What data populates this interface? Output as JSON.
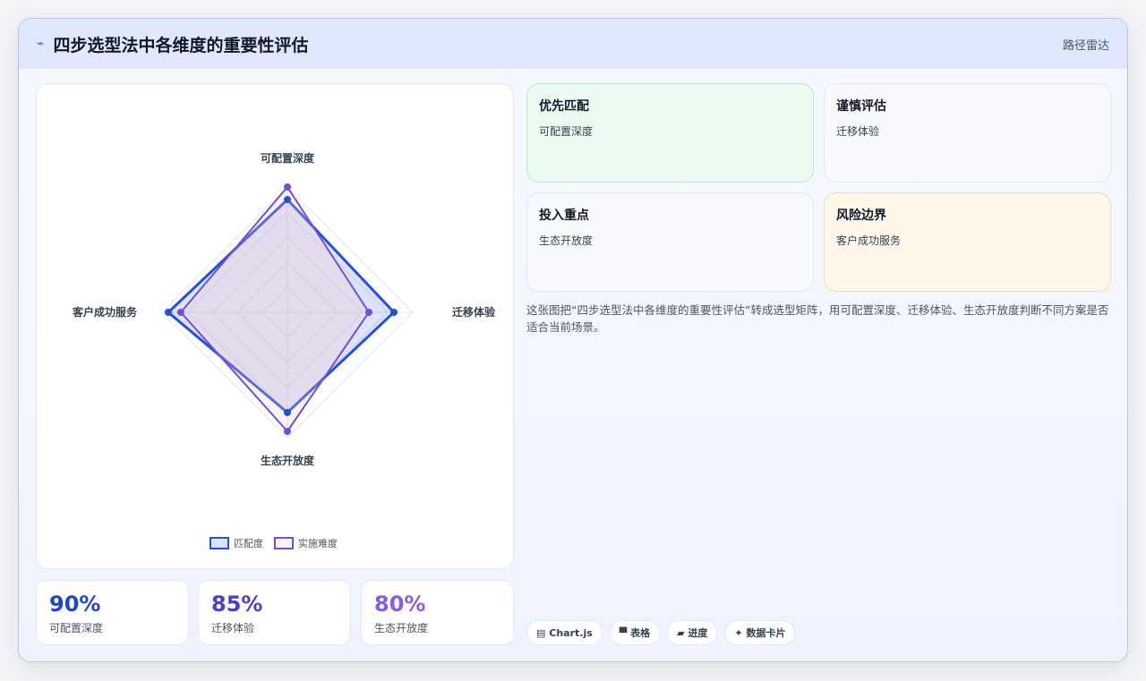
{
  "header": {
    "icon": "sparkline-icon",
    "title": "四步选型法中各维度的重要性评估",
    "right_label": "路径雷达"
  },
  "chart_data": {
    "type": "radar",
    "axes": [
      "可配置深度",
      "迁移体验",
      "生态开放度",
      "客户成功服务"
    ],
    "rmax": 100,
    "series": [
      {
        "name": "匹配度",
        "values": [
          90,
          85,
          80,
          95
        ],
        "color": "#2451d6",
        "fill": "rgba(59,100,230,0.18)"
      },
      {
        "name": "实施难度",
        "values": [
          100,
          65,
          95,
          85
        ],
        "color": "#6d4fd8",
        "fill": "rgba(250,200,200,0.25)"
      }
    ],
    "legend_position": "bottom"
  },
  "stats": [
    {
      "value": "90%",
      "label": "可配置深度",
      "color": "#2045c8"
    },
    {
      "value": "85%",
      "label": "迁移体验",
      "color": "#4b3fc6"
    },
    {
      "value": "80%",
      "label": "生态开放度",
      "color": "#8b5be6"
    }
  ],
  "cards": [
    {
      "title": "优先匹配",
      "text": "可配置深度",
      "bg": "#ecfbf2",
      "border": "#bfe8cf"
    },
    {
      "title": "谨慎评估",
      "text": "迁移体验",
      "bg": "#f8fafd",
      "border": "#e2e8f0"
    },
    {
      "title": "投入重点",
      "text": "生态开放度",
      "bg": "#f8fafd",
      "border": "#e2e8f0"
    },
    {
      "title": "风险边界",
      "text": "客户成功服务",
      "bg": "#fff7e9",
      "border": "#f4dcaa"
    }
  ],
  "description": "这张图把“四步选型法中各维度的重要性评估”转成选型矩阵，用可配置深度、迁移体验、生态开放度判断不同方案是否适合当前场景。",
  "tags": [
    {
      "icon": "▤",
      "label": "Chart.js"
    },
    {
      "icon": "▀",
      "label": "表格"
    },
    {
      "icon": "▰",
      "label": "进度"
    },
    {
      "icon": "✦",
      "label": "数据卡片"
    }
  ]
}
